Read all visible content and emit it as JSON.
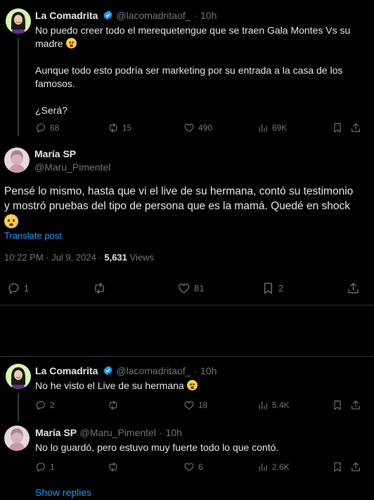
{
  "tweet1": {
    "name": "La Comadrita",
    "handle": "@lacomadritaof_",
    "sep": "·",
    "time": "10h",
    "line1": "No puedo creer todo el merequetengue que se traen Gala Montes Vs su",
    "line2": "madre",
    "line3": "Aunque todo esto podría ser marketing por su entrada a la casa de los",
    "line4": "famosos.",
    "line5": "¿Será?",
    "replies": "68",
    "reposts": "15",
    "likes": "490",
    "views": "69K"
  },
  "main": {
    "name": "María SP",
    "handle": "@Maru_Pimentel",
    "line1": "Pensé lo mismo, hasta que vi el live de su hermana, contó su testimonio",
    "line2": "y mostró pruebas del tipo de persona que es la mamá. Quedé en shock",
    "translate": "Translate post",
    "timestamp": "10:22 PM · Jul 9, 2024 · ",
    "views_count": "5,631",
    "views_label": " Views",
    "replies": "1",
    "reposts": "",
    "likes": "81",
    "bookmarks": "2"
  },
  "reply1": {
    "name": "La Comadrita",
    "handle": "@lacomadritaof_",
    "sep": "·",
    "time": "10h",
    "text": "No he visto el Live de su hermana",
    "replies": "2",
    "likes": "18",
    "views": "5.4K"
  },
  "reply2": {
    "name": "María SP",
    "handle": "@Maru_Pimentel",
    "sep": "·",
    "time": "10h",
    "text": "No lo guardó, pero estuvo muy fuerte todo lo que contó.",
    "replies": "1",
    "likes": "6",
    "views": "2.6K"
  },
  "show_replies": "Show replies",
  "colors": {
    "background": "#000000",
    "text": "#e7e9ea",
    "muted": "#71767b",
    "accent": "#1d9bf0",
    "divider": "#2f3336"
  }
}
